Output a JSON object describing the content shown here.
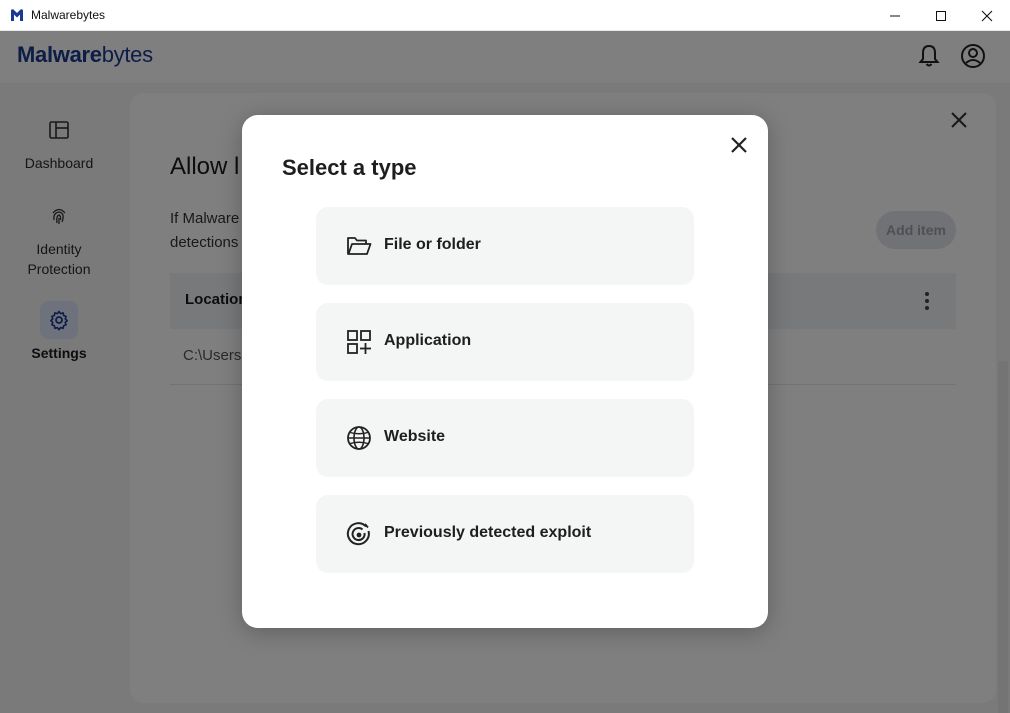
{
  "window": {
    "title": "Malwarebytes",
    "logo_color": "#1a3a8f"
  },
  "header": {
    "brand_bold": "Malware",
    "brand_light": "bytes",
    "icons": [
      "bell-icon",
      "account-icon"
    ]
  },
  "sidebar": {
    "items": [
      {
        "label": "Dashboard",
        "icon": "dashboard-icon",
        "active": false
      },
      {
        "label": "Identity Protection",
        "icon": "fingerprint-icon",
        "active": false
      },
      {
        "label": "Settings",
        "icon": "gear-icon",
        "active": true
      }
    ]
  },
  "panel": {
    "title": "Allow l",
    "description_line1": "If Malware",
    "description_line2": "detections",
    "add_button": "Add item",
    "table": {
      "header_location": "Location",
      "rows": [
        {
          "path": "C:\\Users"
        }
      ]
    }
  },
  "modal": {
    "title": "Select a type",
    "options": [
      {
        "label": "File or folder",
        "icon": "folder-icon"
      },
      {
        "label": "Application",
        "icon": "application-icon"
      },
      {
        "label": "Website",
        "icon": "globe-icon"
      },
      {
        "label": "Previously detected exploit",
        "icon": "exploit-icon"
      }
    ]
  },
  "colors": {
    "accent": "#1a3a8f",
    "backdrop": "rgba(0,0,0,0.5)",
    "option_bg": "#f4f5f5"
  }
}
